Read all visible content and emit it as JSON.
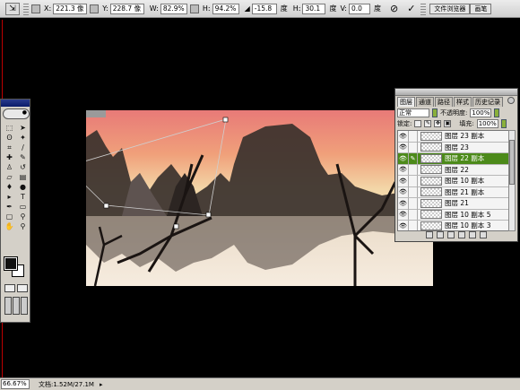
{
  "options_bar": {
    "x_label": "X:",
    "x_value": "221.3 像",
    "y_label": "Y:",
    "y_value": "228.7 像",
    "w_label": "W:",
    "w_value": "82.9%",
    "h_label": "H:",
    "h_value": "94.2%",
    "angle_value": "-15.8",
    "angle_unit": "度",
    "hskew_label": "H:",
    "hskew_value": "30.1",
    "hskew_unit": "度",
    "vskew_label": "V:",
    "vskew_value": "0.0",
    "vskew_unit": "度",
    "cancel_icon": "cancel-icon",
    "commit_icon": "checkmark-icon",
    "file_browser_tab": "文件浏览器",
    "brushes_tab": "画笔"
  },
  "layers_panel": {
    "tabs": [
      "图层",
      "通道",
      "路径",
      "样式",
      "历史记录"
    ],
    "blend_mode": "正常",
    "opacity_label": "不透明度:",
    "opacity_value": "100%",
    "lock_label": "锁定:",
    "fill_label": "填充:",
    "fill_value": "100%",
    "layers": [
      {
        "name": "图层 23 副本",
        "visible": true,
        "selected": false
      },
      {
        "name": "图层 23",
        "visible": true,
        "selected": false
      },
      {
        "name": "图层 22 副本",
        "visible": true,
        "selected": true
      },
      {
        "name": "图层 22",
        "visible": true,
        "selected": false
      },
      {
        "name": "图层 10 副本",
        "visible": true,
        "selected": false
      },
      {
        "name": "图层 21 副本",
        "visible": true,
        "selected": false
      },
      {
        "name": "图层 21",
        "visible": true,
        "selected": false
      },
      {
        "name": "图层 10 副本 5",
        "visible": true,
        "selected": false
      },
      {
        "name": "图层 10 副本 3",
        "visible": true,
        "selected": false
      }
    ]
  },
  "status_bar": {
    "zoom": "66.67%",
    "doc_info": "文档:1.52M/27.1M"
  },
  "colors": {
    "selected_layer": "#4c8a1a",
    "foreground": "#111111",
    "background": "#ffffff"
  }
}
